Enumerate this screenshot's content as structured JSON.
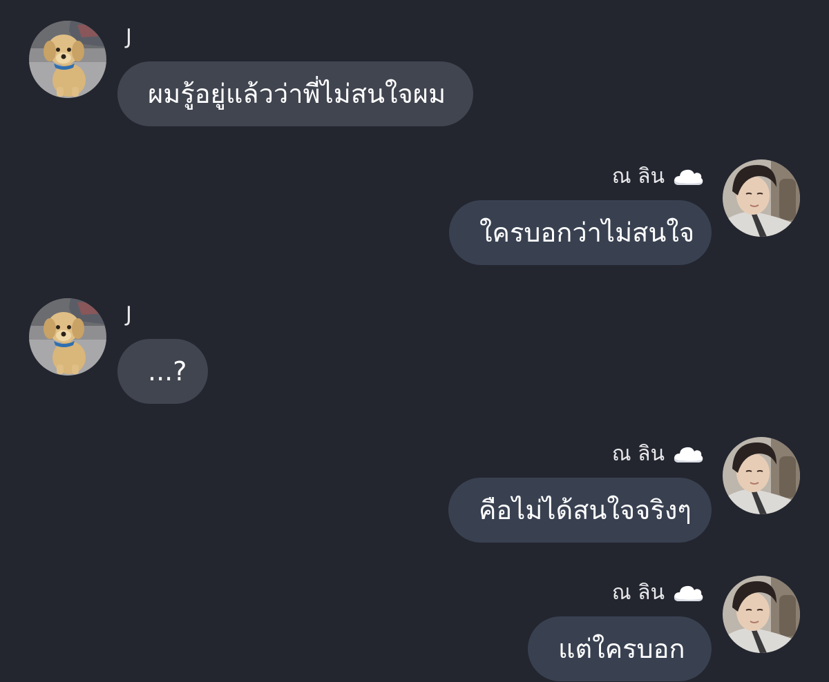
{
  "messages": [
    {
      "sender": "J",
      "side": "left",
      "text": "ผมรู้อยู่แล้วว่าพี่ไม่สนใจผม",
      "avatar": "puppy-avatar"
    },
    {
      "sender": "ณ ลิน",
      "side": "right",
      "text": "ใครบอกว่าไม่สนใจ",
      "avatar": "person-avatar",
      "name_icon": "cloud-icon"
    },
    {
      "sender": "J",
      "side": "left",
      "text": "...?",
      "avatar": "puppy-avatar"
    },
    {
      "sender": "ณ ลิน",
      "side": "right",
      "text": "คือไม่ได้สนใจจริงๆ",
      "avatar": "person-avatar",
      "name_icon": "cloud-icon"
    },
    {
      "sender": "ณ ลิน",
      "side": "right",
      "text": "แต่ใครบอก",
      "avatar": "person-avatar",
      "name_icon": "cloud-icon"
    }
  ],
  "colors": {
    "background": "#23262f",
    "incoming_bubble": "#414550",
    "outgoing_bubble": "#394151",
    "text": "#ffffff"
  }
}
